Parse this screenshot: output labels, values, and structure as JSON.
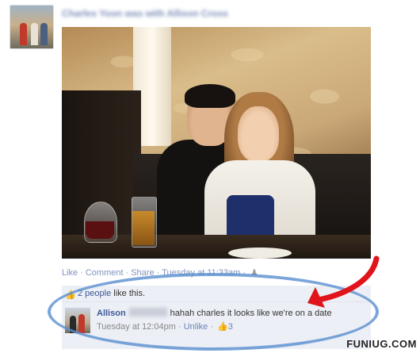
{
  "post": {
    "title": "Charles Yoon was with Allison Cross"
  },
  "actions": {
    "like": "Like",
    "comment": "Comment",
    "share": "Share",
    "timestamp": "Tuesday at 11:33am",
    "separator": "·"
  },
  "likes": {
    "count_text": "2 people",
    "suffix": " like this."
  },
  "comment": {
    "author_first": "Allison",
    "text": "hahah charles it looks like we're on a date",
    "timestamp": "Tuesday at 12:04pm",
    "unlike": "Unlike",
    "like_count": "3",
    "separator": "·"
  },
  "annotation": {
    "ellipse_color": "#5a8fd0",
    "arrow_color": "#e0141a"
  },
  "watermark": {
    "text": "FUNIUG.COM"
  },
  "icons": {
    "like": "thumbs-up-icon",
    "audience": "friends-icon"
  }
}
